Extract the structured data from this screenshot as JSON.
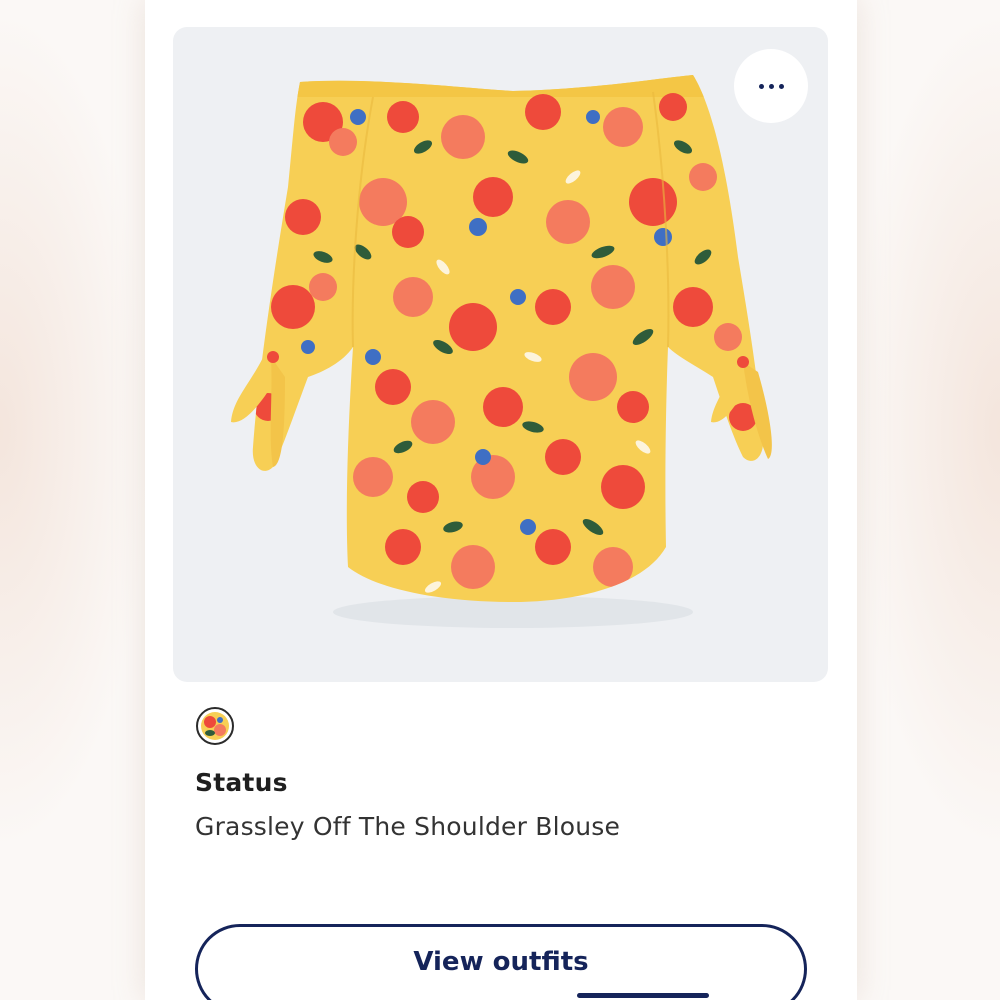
{
  "product_card": {
    "image_alt": "Grassley Off The Shoulder Blouse",
    "more_options_icon": "more-horizontal-icon",
    "swatch_icon": "floral-swatch",
    "brand": "Status",
    "name": "Grassley Off The Shoulder Blouse",
    "cta_label": "View outfits"
  },
  "colors": {
    "accent_navy": "#15245a",
    "panel_bg": "#eef0f3",
    "blouse_yellow": "#f7cf55",
    "flower_red": "#ee4a3b",
    "flower_coral": "#f47b5e",
    "leaf_green": "#2f5c3a",
    "flower_blue": "#3f6fc4"
  }
}
